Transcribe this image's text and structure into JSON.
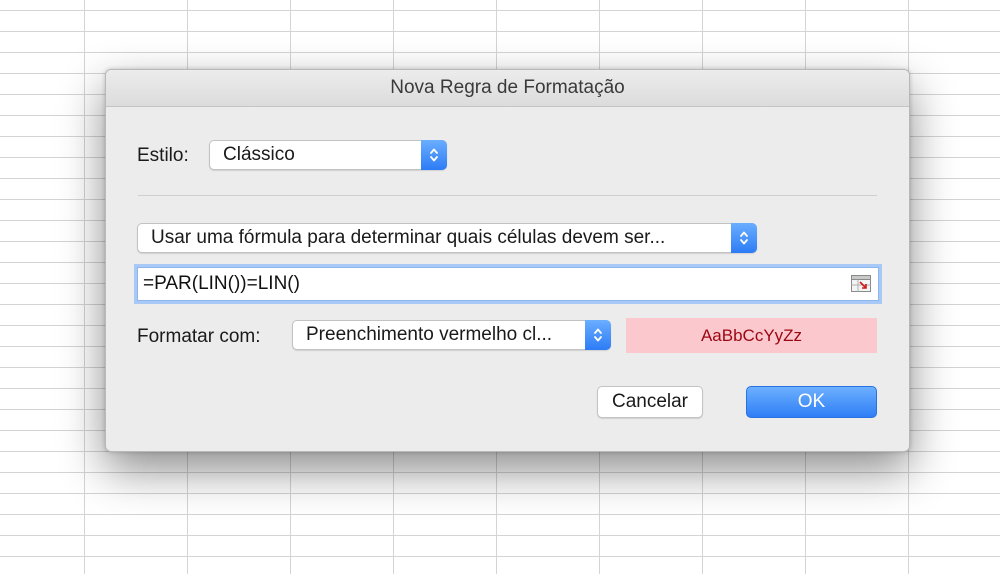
{
  "dialog": {
    "title": "Nova Regra de Formatação",
    "style_label": "Estilo:",
    "style_value": "Clássico",
    "rule_type_value": "Usar uma fórmula para determinar quais células devem ser...",
    "formula_value": "=PAR(LIN())=LIN()",
    "format_with_label": "Formatar com:",
    "format_with_value": "Preenchimento vermelho cl...",
    "preview_text": "AaBbCcYyZz",
    "cancel_label": "Cancelar",
    "ok_label": "OK"
  },
  "colors": {
    "accent_blue": "#3b8cf8",
    "preview_fill": "#fbc8cd",
    "preview_text": "#9c0613"
  },
  "icons": {
    "popup_arrows": "chevron-up-down-icon",
    "collapse_dialog": "range-selector-icon"
  }
}
